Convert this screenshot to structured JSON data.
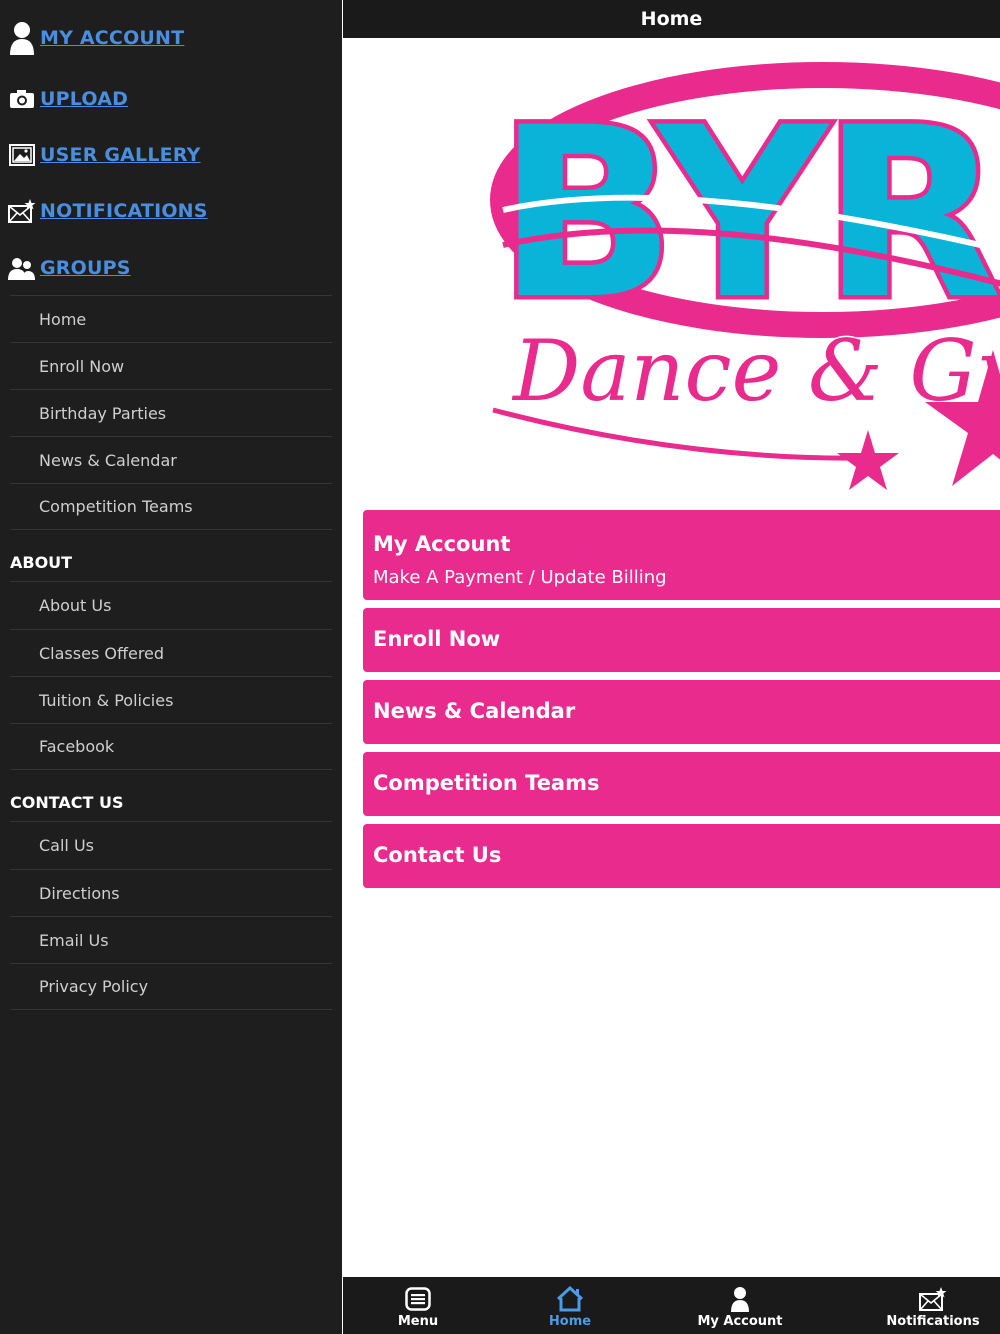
{
  "sidebar": {
    "top_links": [
      {
        "label": "MY ACCOUNT",
        "icon": "person-icon"
      },
      {
        "label": "UPLOAD",
        "icon": "camera-icon"
      },
      {
        "label": "USER GALLERY",
        "icon": "image-icon"
      },
      {
        "label": "NOTIFICATIONS",
        "icon": "envelope-star-icon"
      },
      {
        "label": "GROUPS",
        "icon": "group-icon"
      }
    ],
    "group_items": [
      "Home",
      "Enroll Now",
      "Birthday Parties",
      "News & Calendar",
      "Competition Teams"
    ],
    "about_head": "ABOUT",
    "about_items": [
      "About Us",
      "Classes Offered",
      "Tuition & Policies",
      "Facebook"
    ],
    "contact_head": "CONTACT US",
    "contact_items": [
      "Call Us",
      "Directions",
      "Email Us",
      "Privacy Policy"
    ]
  },
  "header": {
    "title": "Home"
  },
  "logo": {
    "line1": "BYRD",
    "line2": "Dance & Gym"
  },
  "buttons": [
    {
      "title": "My Account",
      "subtitle": "Make A Payment / Update Billing"
    },
    {
      "title": "Enroll Now"
    },
    {
      "title": "News & Calendar"
    },
    {
      "title": "Competition Teams"
    },
    {
      "title": "Contact Us"
    }
  ],
  "tabbar": {
    "tabs": [
      {
        "label": "Menu",
        "icon": "menu-icon"
      },
      {
        "label": "Home",
        "icon": "home-icon"
      },
      {
        "label": "My Account",
        "icon": "person-icon"
      },
      {
        "label": "Notifications",
        "icon": "envelope-star-icon"
      }
    ],
    "active": "Home"
  },
  "colors": {
    "accent": "#e92b8d",
    "link": "#4a8ee0",
    "sidebar_bg": "#1e1e1e",
    "active_tab": "#4a9be8",
    "logo_blue": "#0ab4d8"
  }
}
